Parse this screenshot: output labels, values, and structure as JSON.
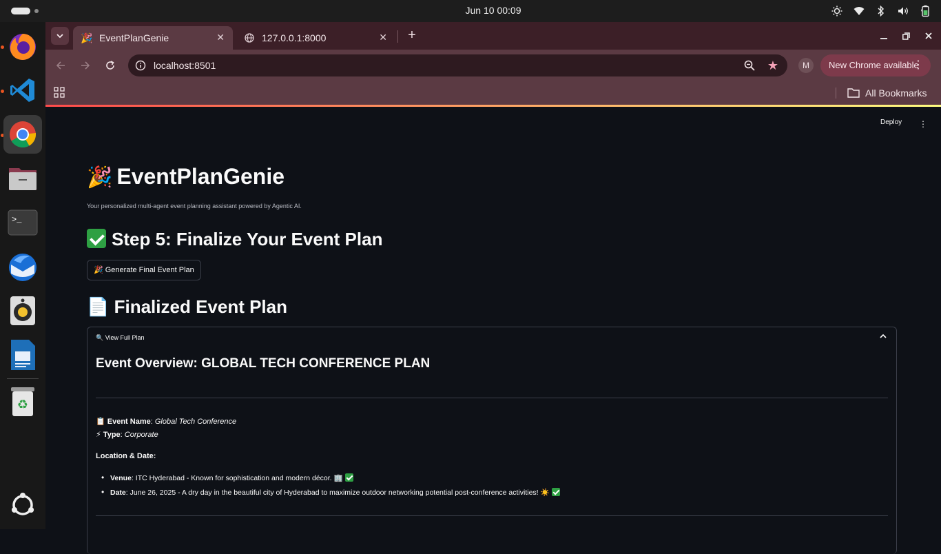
{
  "system": {
    "clock": "Jun 10  00:09",
    "tray": [
      "brightness-icon",
      "wifi-icon",
      "bluetooth-icon",
      "volume-icon",
      "battery-icon"
    ]
  },
  "dock": {
    "apps": [
      "Firefox",
      "Visual Studio Code",
      "Google Chrome",
      "Files",
      "Terminal",
      "Thunderbird",
      "Rhythmbox",
      "LibreOffice Writer",
      "Trash",
      "Show Applications"
    ]
  },
  "browser": {
    "tabs": [
      {
        "title": "EventPlanGenie",
        "active": true
      },
      {
        "title": "127.0.0.1:8000",
        "active": false
      }
    ],
    "url": "localhost:8501",
    "profile_initial": "M",
    "update_label": "New Chrome available",
    "bookmarks_label": "All Bookmarks"
  },
  "app": {
    "deploy_label": "Deploy",
    "title_emoji": "🎉",
    "title": "EventPlanGenie",
    "subtitle": "Your personalized multi-agent event planning assistant powered by Agentic AI.",
    "step_heading": "Step 5: Finalize Your Event Plan",
    "generate_button": "🎉 Generate Final Event Plan",
    "final_heading_emoji": "📄",
    "final_heading": "Finalized Event Plan",
    "expander_label": "🔍 View Full Plan",
    "overview_title": "Event Overview: GLOBAL TECH CONFERENCE PLAN",
    "event_name_icon": "📋",
    "event_name_label": "Event Name",
    "event_name_value": "Global Tech Conference",
    "type_icon": "⚡",
    "type_label": "Type",
    "type_value": "Corporate",
    "location_date_label": "Location & Date:",
    "venue_label": "Venue",
    "venue_value": ": ITC Hyderabad - Known for sophistication and modern décor. 🏢",
    "date_label": "Date",
    "date_value": ": June 26, 2025 - A dry day in the beautiful city of Hyderabad to maximize outdoor networking potential post-conference activities! ☀️"
  }
}
